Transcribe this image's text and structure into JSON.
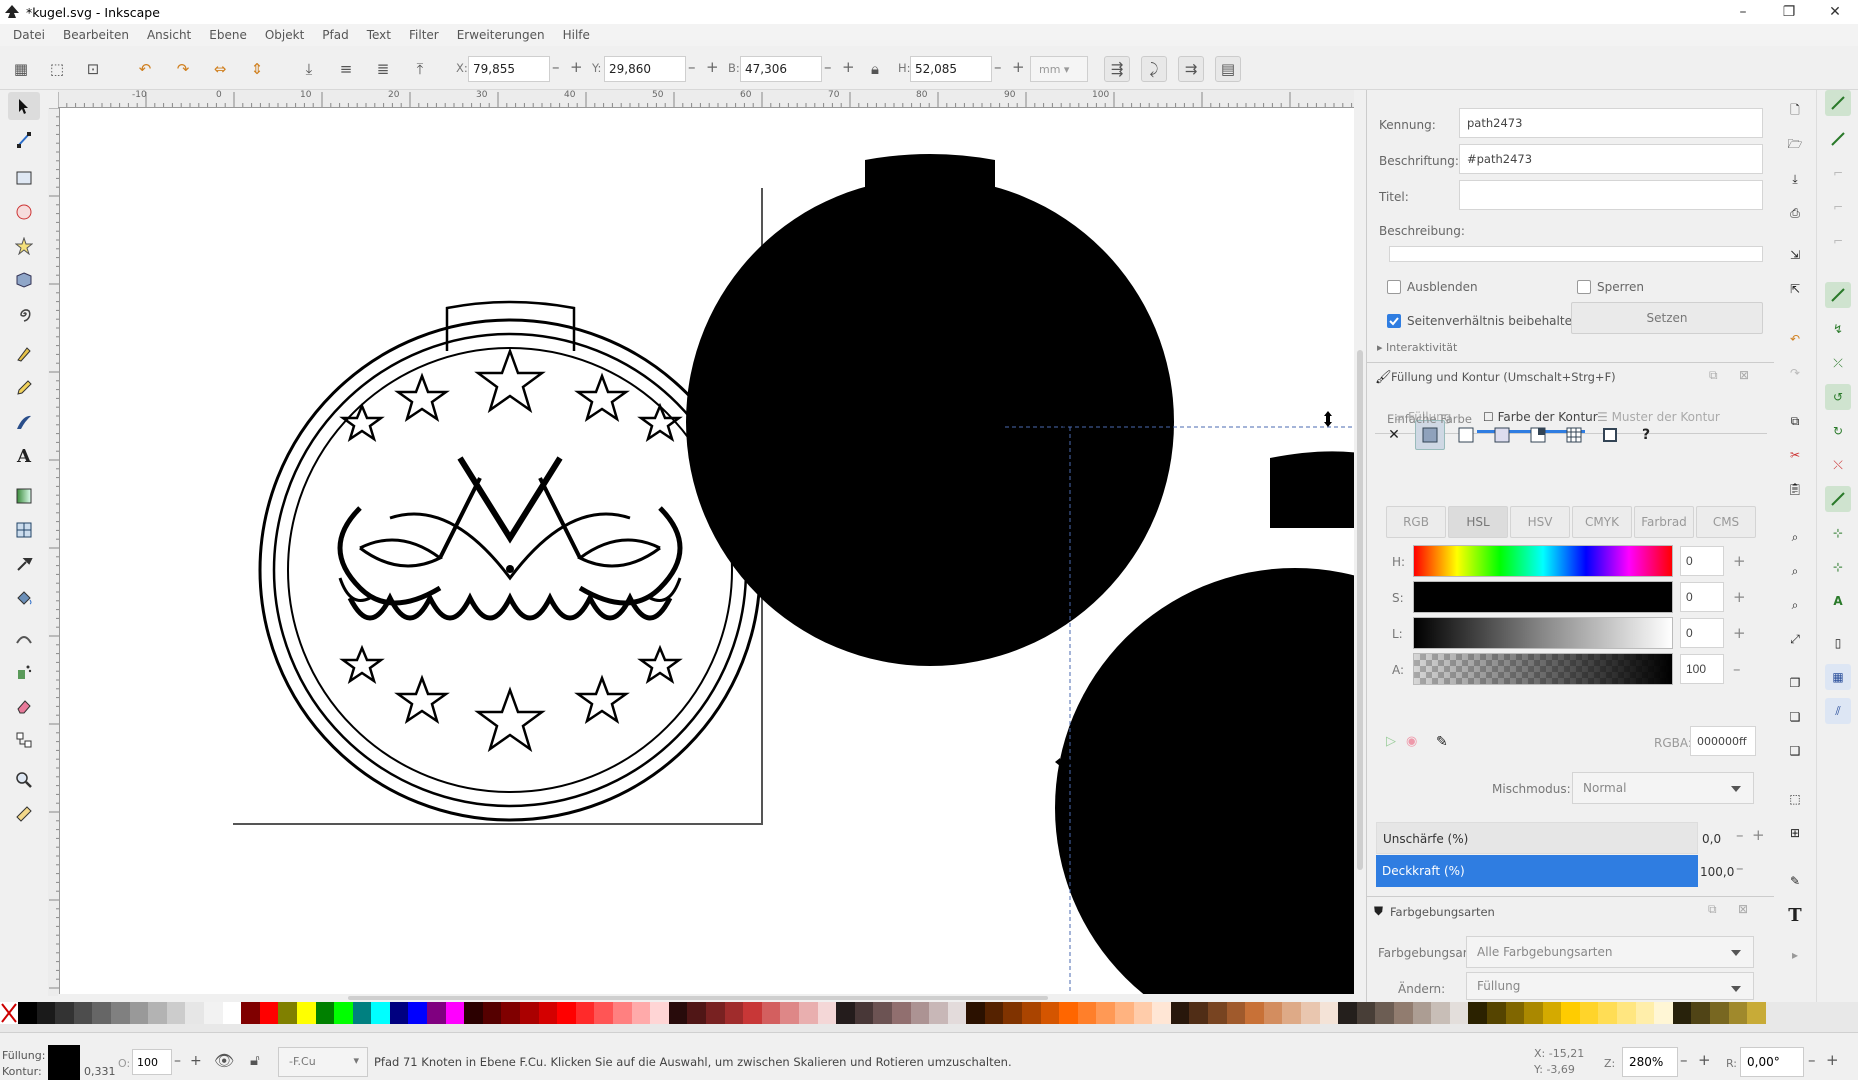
{
  "window": {
    "title": "*kugel.svg - Inkscape",
    "minimize": "–",
    "maximize": "❐",
    "close": "✕"
  },
  "menu": [
    "Datei",
    "Bearbeiten",
    "Ansicht",
    "Ebene",
    "Objekt",
    "Pfad",
    "Text",
    "Filter",
    "Erweiterungen",
    "Hilfe"
  ],
  "toolbar": {
    "x_label": "X:",
    "x_value": "79,855",
    "y_label": "Y:",
    "y_value": "29,860",
    "w_label": "B:",
    "w_value": "47,306",
    "h_label": "H:",
    "h_value": "52,085",
    "units": "mm",
    "minus": "–",
    "plus": "+"
  },
  "ruler": {
    "labels": [
      "-10",
      "0",
      "10",
      "20",
      "30",
      "40",
      "50",
      "60",
      "70",
      "80",
      "90",
      "100"
    ]
  },
  "object_props": {
    "id_label": "Kennung:",
    "id_value": "path2473",
    "label_label": "Beschriftung:",
    "label_value": "#path2473",
    "title_label": "Titel:",
    "title_value": "",
    "desc_label": "Beschreibung:",
    "hide_label": "Ausblenden",
    "lock_label": "Sperren",
    "aspect_label": "Seitenverhältnis beibehalten",
    "set_button": "Setzen",
    "interactivity": "Interaktivität"
  },
  "fill_stroke": {
    "header": "Füllung und Kontur (Umschalt+Strg+F)",
    "tabs": [
      "Füllung",
      "Farbe der Kontur",
      "Muster der Kontur"
    ],
    "unset_symbol": "✕",
    "unknown_symbol": "?",
    "flat_color_label": "Einfache Farbe",
    "color_modes": [
      "RGB",
      "HSL",
      "HSV",
      "CMYK",
      "Farbrad",
      "CMS"
    ],
    "sliders": [
      {
        "label": "H:",
        "value": "0"
      },
      {
        "label": "S:",
        "value": "0"
      },
      {
        "label": "L:",
        "value": "0"
      },
      {
        "label": "A:",
        "value": "100"
      }
    ],
    "rgba_label": "RGBA:",
    "rgba_value": "000000ff",
    "blend_label": "Mischmodus:",
    "blend_value": "Normal",
    "blur_label": "Unschärfe (%)",
    "blur_value": "0,0",
    "opacity_label": "Deckkraft (%)",
    "opacity_value": "100,0"
  },
  "paint_servers": {
    "header": "Farbgebungsarten",
    "type_label": "Farbgebungsart:",
    "type_value": "Alle Farbgebungsarten",
    "change_label": "Ändern:",
    "change_value": "Füllung"
  },
  "status": {
    "fill_label": "Füllung:",
    "stroke_label": "Kontur:",
    "stroke_width": "0,331",
    "opacity_label": "O:",
    "opacity_value": "100",
    "layer": "-F.Cu",
    "message": "Pfad 71 Knoten in Ebene F.Cu. Klicken Sie auf die Auswahl, um zwischen Skalieren und Rotieren umzuschalten.",
    "x_coord": "X: -15,21",
    "y_coord": "Y: -3,69",
    "zoom_label": "Z:",
    "zoom_value": "280%",
    "rot_label": "R:",
    "rot_value": "0,00°"
  },
  "colors": {
    "accent": "#2f7de1",
    "selection": "#4a6ab0"
  },
  "palette": [
    "#000000",
    "#1a1a1a",
    "#333333",
    "#4d4d4d",
    "#666666",
    "#808080",
    "#999999",
    "#b3b3b3",
    "#cccccc",
    "#e6e6e6",
    "#f2f2f2",
    "#ffffff",
    "#800000",
    "#ff0000",
    "#808000",
    "#ffff00",
    "#008000",
    "#00ff00",
    "#008080",
    "#00ffff",
    "#000080",
    "#0000ff",
    "#800080",
    "#ff00ff",
    "#2b0000",
    "#550000",
    "#800000",
    "#aa0000",
    "#d40000",
    "#ff0000",
    "#ff2a2a",
    "#ff5555",
    "#ff8080",
    "#ffaaaa",
    "#ffd5d5",
    "#280b0b",
    "#501616",
    "#782121",
    "#a02c2c",
    "#c83737",
    "#d35f5f",
    "#de8787",
    "#e9afaf",
    "#f4d7d7",
    "#241c1c",
    "#483737",
    "#6c5353",
    "#916f6f",
    "#ac9393",
    "#c8b7b7",
    "#e3dbdb",
    "#2b1100",
    "#552200",
    "#803300",
    "#aa4400",
    "#d45500",
    "#ff6600",
    "#ff7f2a",
    "#ff9955",
    "#ffb380",
    "#ffccaa",
    "#ffe6d5",
    "#28170b",
    "#502d16",
    "#784421",
    "#a05a2c",
    "#c87137",
    "#d38d5f",
    "#deaa87",
    "#e9c6af",
    "#f4e3d7",
    "#241f1c",
    "#483e37",
    "#6c5d53",
    "#917c6f",
    "#ac9d93",
    "#c8beb7",
    "#e3dedb",
    "#2b2200",
    "#554400",
    "#806600",
    "#aa8800",
    "#d4aa00",
    "#ffcc00",
    "#ffd42a",
    "#ffdd55",
    "#ffe680",
    "#ffeeaa",
    "#fff6d5",
    "#28220b",
    "#504416",
    "#786721",
    "#a0892c",
    "#c8ab37"
  ]
}
